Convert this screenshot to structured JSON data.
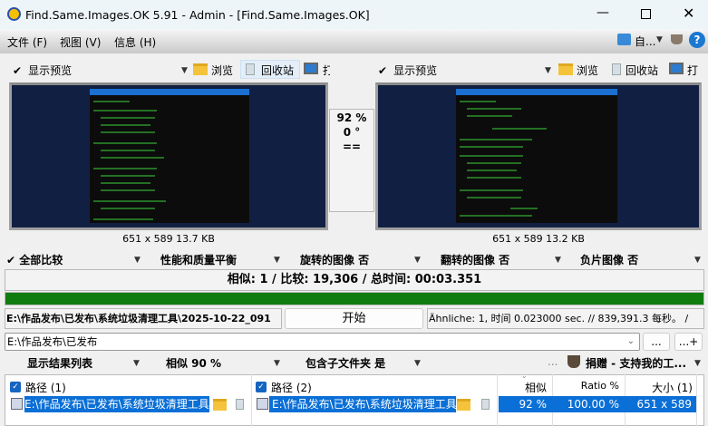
{
  "window": {
    "title": "Find.Same.Images.OK 5.91 - Admin - [Find.Same.Images.OK]"
  },
  "menu": [
    "文件 (F)",
    "视图 (V)",
    "信息 (H)"
  ],
  "menu_right": {
    "lang": "自...",
    "help": "?"
  },
  "left_toolbar": {
    "show_preview": "显示预览",
    "browse": "浏览",
    "recycle": "回收站",
    "print": "打"
  },
  "right_toolbar": {
    "show_preview": "显示预览",
    "browse": "浏览",
    "recycle": "回收站",
    "print": "打"
  },
  "compare": {
    "similarity": "92 %",
    "rotation": "0 °",
    "equal": "=="
  },
  "left_caption": "651 x 589 13.7 KB",
  "right_caption": "651 x 589 13.2 KB",
  "options": [
    "全部比较",
    "性能和质量平衡",
    "旋转的图像 否",
    "翻转的图像 否",
    "负片图像 否"
  ],
  "status": "相似: 1 / 比较: 19,306 / 总时间: 00:03.351",
  "progress": 100,
  "current_path": "E:\\作品发布\\已发布\\系统垃圾清理工具\\2025-10-22_091",
  "start_label": "开始",
  "info": "Ähnliche: 1, 时间 0.023000 sec. // 839,391.3 每秒。 /",
  "folder_input": "E:\\作品发布\\已发布",
  "btn_browse": "...",
  "btn_add": "...+",
  "filters": {
    "view": "显示结果列表",
    "similar": "相似 90 %",
    "subfolders": "包含子文件夹 是",
    "more": "...",
    "donate": "捐赠 - 支持我的工..."
  },
  "table": {
    "headers": [
      "路径 (1)",
      "路径 (2)",
      "相似",
      "Ratio %",
      "大小 (1)"
    ],
    "rows": [
      {
        "path1": "E:\\作品发布\\已发布\\系统垃圾清理工具",
        "path2": "E:\\作品发布\\已发布\\系统垃圾清理工具",
        "similar": "92 %",
        "ratio": "100.00 %",
        "size": "651 x 589"
      }
    ]
  },
  "colors": {
    "progress": "#107c10",
    "selection": "#0a6fd6",
    "preview_bg": "#111f42"
  }
}
